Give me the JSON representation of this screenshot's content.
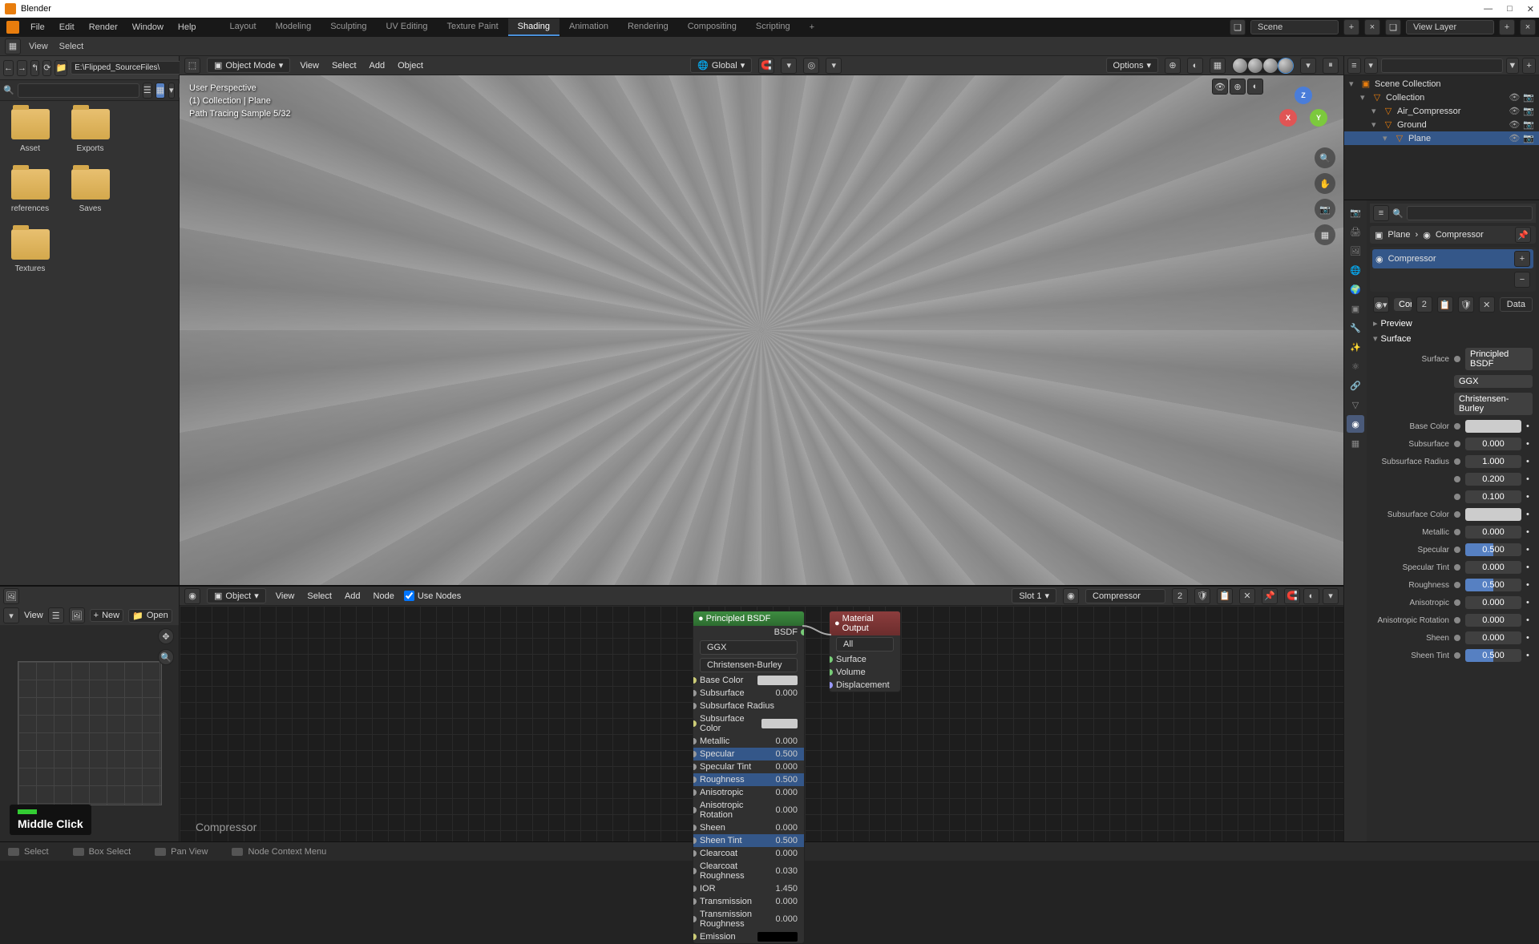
{
  "app": {
    "title": "Blender"
  },
  "menu": {
    "file": "File",
    "edit": "Edit",
    "render": "Render",
    "window": "Window",
    "help": "Help"
  },
  "workspaces": [
    "Layout",
    "Modeling",
    "Sculpting",
    "UV Editing",
    "Texture Paint",
    "Shading",
    "Animation",
    "Rendering",
    "Compositing",
    "Scripting"
  ],
  "workspace_active_index": 5,
  "scene_label": "Scene",
  "viewlayer_label": "View Layer",
  "secondbar": {
    "view": "View",
    "select": "Select"
  },
  "filebrowser": {
    "path": "E:\\Flipped_SourceFiles\\",
    "folders": [
      "Asset",
      "Exports",
      "references",
      "Saves",
      "Textures"
    ]
  },
  "viewport": {
    "mode": "Object Mode",
    "menus": {
      "view": "View",
      "select": "Select",
      "add": "Add",
      "object": "Object"
    },
    "orientation": "Global",
    "options": "Options",
    "overlay": {
      "line1": "User Perspective",
      "line2": "(1) Collection | Plane",
      "line3": "Path Tracing Sample 5/32"
    }
  },
  "imgeditor": {
    "view": "View",
    "new": "New",
    "open": "Open"
  },
  "keyhint": "Middle Click",
  "nodeeditor": {
    "menus": {
      "object": "Object",
      "view": "View",
      "select": "Select",
      "add": "Add",
      "node": "Node",
      "usenodes": "Use Nodes"
    },
    "slot": "Slot 1",
    "material": "Compressor",
    "material_users": "2",
    "breadcrumb": "Compressor",
    "bsdf_node": {
      "title": "Principled BSDF",
      "out_bsdf": "BSDF",
      "distribution": "GGX",
      "sss_method": "Christensen-Burley",
      "rows": [
        {
          "name": "Base Color",
          "type": "color",
          "value": "#cccccc"
        },
        {
          "name": "Subsurface",
          "type": "value",
          "value": "0.000"
        },
        {
          "name": "Subsurface Radius",
          "type": "vector",
          "value": ""
        },
        {
          "name": "Subsurface Color",
          "type": "color",
          "value": "#cccccc"
        },
        {
          "name": "Metallic",
          "type": "value",
          "value": "0.000"
        },
        {
          "name": "Specular",
          "type": "value",
          "value": "0.500",
          "sel": true
        },
        {
          "name": "Specular Tint",
          "type": "value",
          "value": "0.000"
        },
        {
          "name": "Roughness",
          "type": "value",
          "value": "0.500",
          "sel": true
        },
        {
          "name": "Anisotropic",
          "type": "value",
          "value": "0.000"
        },
        {
          "name": "Anisotropic Rotation",
          "type": "value",
          "value": "0.000"
        },
        {
          "name": "Sheen",
          "type": "value",
          "value": "0.000"
        },
        {
          "name": "Sheen Tint",
          "type": "value",
          "value": "0.500",
          "sel": true
        },
        {
          "name": "Clearcoat",
          "type": "value",
          "value": "0.000"
        },
        {
          "name": "Clearcoat Roughness",
          "type": "value",
          "value": "0.030"
        },
        {
          "name": "IOR",
          "type": "value",
          "value": "1.450"
        },
        {
          "name": "Transmission",
          "type": "value",
          "value": "0.000"
        },
        {
          "name": "Transmission Roughness",
          "type": "value",
          "value": "0.000"
        },
        {
          "name": "Emission",
          "type": "color",
          "value": "#000000"
        }
      ]
    },
    "output_node": {
      "title": "Material Output",
      "target": "All",
      "inputs": [
        "Surface",
        "Volume",
        "Displacement"
      ]
    }
  },
  "outliner": {
    "root": "Scene Collection",
    "items": [
      {
        "name": "Collection",
        "depth": 1
      },
      {
        "name": "Air_Compressor",
        "depth": 2
      },
      {
        "name": "Ground",
        "depth": 2
      },
      {
        "name": "Plane",
        "depth": 3,
        "selected": true
      }
    ]
  },
  "properties": {
    "breadcrumb_obj": "Plane",
    "breadcrumb_mat": "Compressor",
    "material_slot": "Compressor",
    "material_name": "Compres...",
    "material_users": "2",
    "data_label": "Data",
    "section_preview": "Preview",
    "section_surface": "Surface",
    "surface_type": "Principled BSDF",
    "surface_label": "Surface",
    "distribution": "GGX",
    "sss_method": "Christensen-Burley",
    "params": [
      {
        "label": "Base Color",
        "type": "color",
        "value": "#cccccc"
      },
      {
        "label": "Subsurface",
        "type": "value",
        "value": "0.000",
        "pct": 0
      },
      {
        "label": "Subsurface Radius",
        "type": "value",
        "value": "1.000",
        "pct": 0
      },
      {
        "label": "",
        "type": "value",
        "value": "0.200",
        "pct": 0
      },
      {
        "label": "",
        "type": "value",
        "value": "0.100",
        "pct": 0
      },
      {
        "label": "Subsurface Color",
        "type": "color",
        "value": "#cccccc"
      },
      {
        "label": "Metallic",
        "type": "value",
        "value": "0.000",
        "pct": 0
      },
      {
        "label": "Specular",
        "type": "value",
        "value": "0.500",
        "pct": 50
      },
      {
        "label": "Specular Tint",
        "type": "value",
        "value": "0.000",
        "pct": 0
      },
      {
        "label": "Roughness",
        "type": "value",
        "value": "0.500",
        "pct": 50
      },
      {
        "label": "Anisotropic",
        "type": "value",
        "value": "0.000",
        "pct": 0
      },
      {
        "label": "Anisotropic Rotation",
        "type": "value",
        "value": "0.000",
        "pct": 0
      },
      {
        "label": "Sheen",
        "type": "value",
        "value": "0.000",
        "pct": 0
      },
      {
        "label": "Sheen Tint",
        "type": "value",
        "value": "0.500",
        "pct": 50
      }
    ]
  },
  "statusbar": {
    "select": "Select",
    "boxselect": "Box Select",
    "panview": "Pan View",
    "contextmenu": "Node Context Menu"
  }
}
